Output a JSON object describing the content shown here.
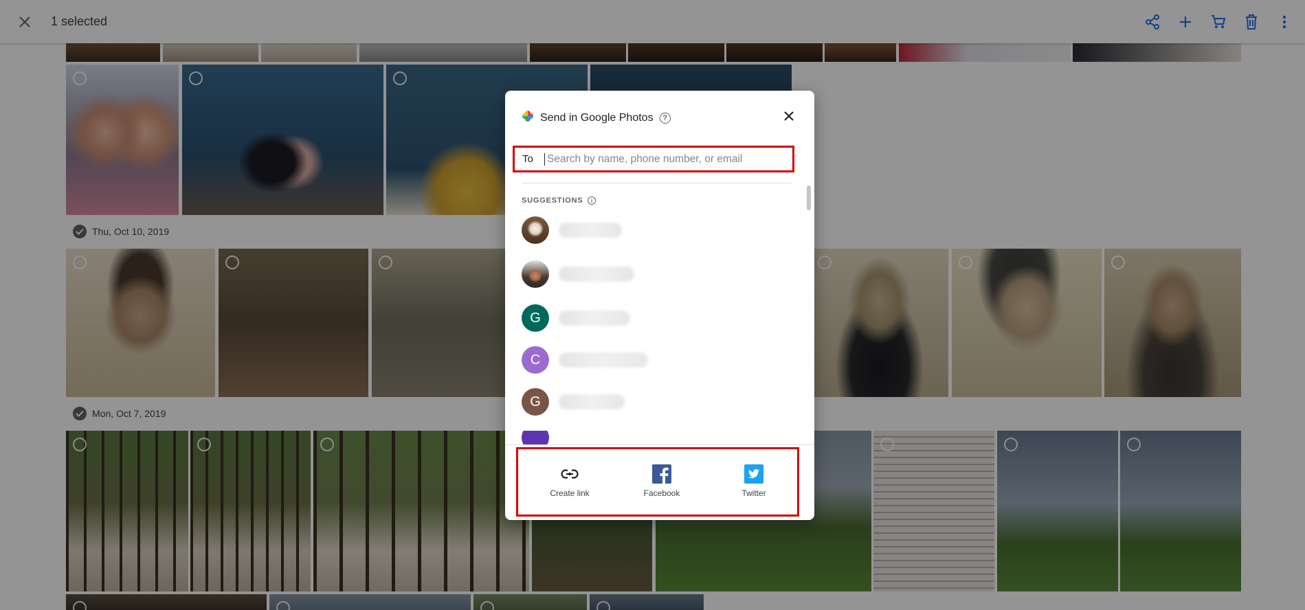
{
  "topbar": {
    "selection_text": "1 selected",
    "icons": [
      "close-icon",
      "share-icon",
      "add-icon",
      "cart-icon",
      "delete-icon",
      "more-vert-icon"
    ]
  },
  "dates": {
    "date1": "Thu, Oct 10, 2019",
    "date2": "Mon, Oct 7, 2019"
  },
  "dialog": {
    "title": "Send in Google Photos",
    "to_label": "To",
    "search_placeholder": "Search by name, phone number, or email",
    "suggestions_header": "SUGGESTIONS",
    "suggestions": [
      {
        "initial": "",
        "color": "#8d6e63"
      },
      {
        "initial": "",
        "color": "#6d5a4a"
      },
      {
        "initial": "G",
        "color": "#00695c"
      },
      {
        "initial": "C",
        "color": "#9c6ad1"
      },
      {
        "initial": "G",
        "color": "#795548"
      },
      {
        "initial": "",
        "color": "#5e35b1"
      }
    ],
    "share_options": {
      "create_link": "Create link",
      "facebook": "Facebook",
      "twitter": "Twitter"
    }
  },
  "colors": {
    "highlight": "#d50000",
    "accent": "#1a73e8",
    "facebook": "#3b5998",
    "twitter": "#1da1f2"
  }
}
